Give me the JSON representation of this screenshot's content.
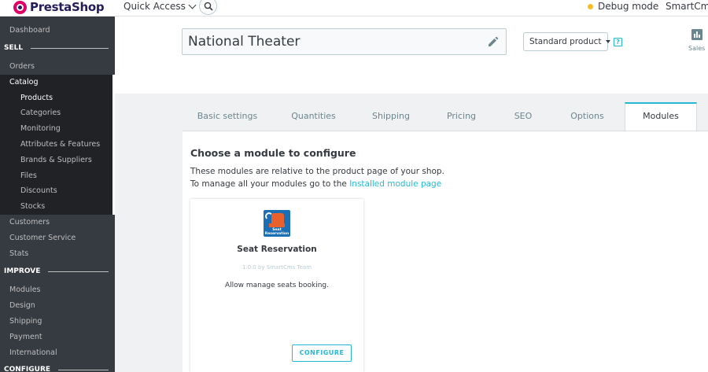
{
  "header": {
    "logo_text": "PrestaShop",
    "quick_access_label": "Quick Access",
    "debug_label": "Debug mode",
    "shop_name": "SmartCms I"
  },
  "sidebar": {
    "dashboard": "Dashboard",
    "sell_section": "SELL",
    "orders": "Orders",
    "catalog": "Catalog",
    "catalog_items": [
      "Products",
      "Categories",
      "Monitoring",
      "Attributes & Features",
      "Brands & Suppliers",
      "Files",
      "Discounts",
      "Stocks"
    ],
    "customers": "Customers",
    "customer_service": "Customer Service",
    "stats": "Stats",
    "improve_section": "IMPROVE",
    "improve_items": [
      "Modules",
      "Design",
      "Shipping",
      "Payment",
      "International"
    ],
    "configure_section": "CONFIGURE"
  },
  "product": {
    "name": "National Theater",
    "type": "Standard product",
    "help": "?",
    "sales_label": "Sales"
  },
  "tabs": [
    "Basic settings",
    "Quantities",
    "Shipping",
    "Pricing",
    "SEO",
    "Options",
    "Modules"
  ],
  "active_tab": "Modules",
  "modules_panel": {
    "title": "Choose a module to configure",
    "description_line1": "These modules are relative to the product page of your shop.",
    "description_line2_prefix": "To manage all your modules go to the ",
    "installed_link": "Installed module page"
  },
  "module_card": {
    "icon_text_line1": "Seat",
    "icon_text_line2": "Reservation",
    "name": "Seat Reservation",
    "version_author": "1.0.0 by SmartCms Team",
    "description": "Allow manage seats booking.",
    "configure_label": "CONFIGURE"
  },
  "colors": {
    "accent": "#25b9d7",
    "sidebar_bg": "#363a41",
    "sidebar_active_bg": "#202226",
    "brand_pink": "#df0067",
    "debug_dot": "#fbbb22"
  }
}
